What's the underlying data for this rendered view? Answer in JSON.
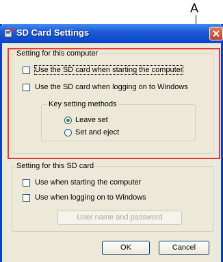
{
  "annotation": {
    "label": "A"
  },
  "window": {
    "title": "SD Card Settings",
    "icon": "sd-card-icon",
    "close_icon": "close-icon"
  },
  "computer_group": {
    "legend": "Setting for this computer",
    "options": [
      {
        "label": "Use the SD card when starting the computer",
        "checked": false
      },
      {
        "label": "Use the SD card when logging on to Windows",
        "checked": false
      }
    ],
    "key_methods": {
      "legend": "Key setting methods",
      "options": [
        {
          "label": "Leave set",
          "selected": true
        },
        {
          "label": "Set and eject",
          "selected": false
        }
      ]
    }
  },
  "card_group": {
    "legend": "Setting for this SD card",
    "options": [
      {
        "label": "Use when starting the computer",
        "checked": false
      },
      {
        "label": "Use when logging on to Windows",
        "checked": false
      }
    ],
    "password_button": "User name and password"
  },
  "buttons": {
    "ok": "OK",
    "cancel": "Cancel"
  },
  "colors": {
    "title_bar": "#0a45c8",
    "highlight_box": "#e53b2e",
    "dialog_bg": "#ece9d8"
  }
}
